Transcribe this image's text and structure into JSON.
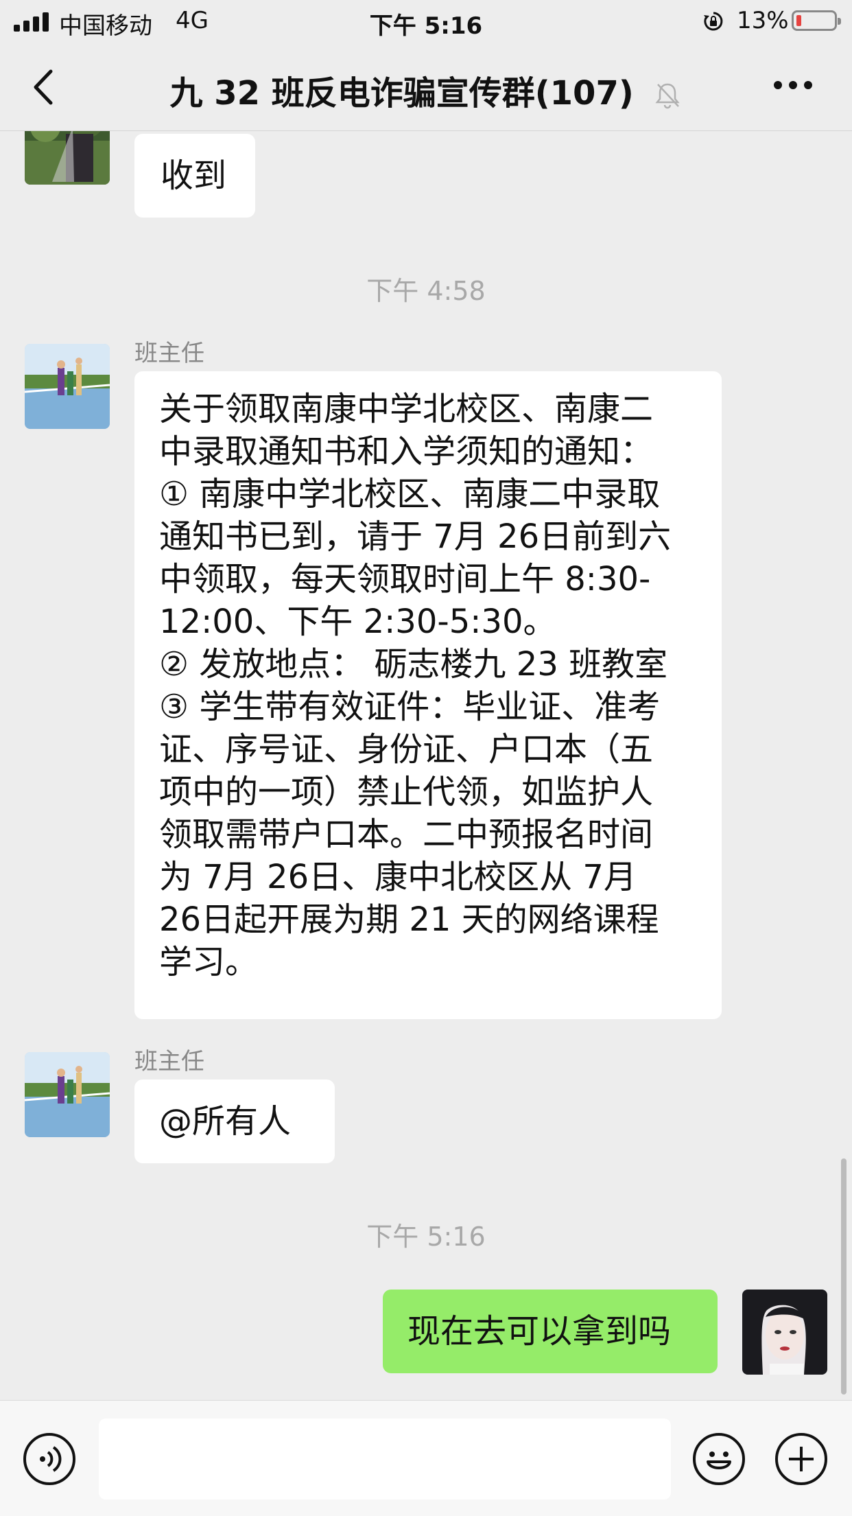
{
  "status_bar": {
    "carrier": "中国移动",
    "network": "4G",
    "time": "下午 5:16",
    "battery_percent": "13%",
    "battery_level": 0.13
  },
  "nav": {
    "title": "九 32 班反电诈骗宣传群(107)",
    "back_icon": "chevron-left-icon",
    "mute_icon": "bell-slash-icon",
    "more_icon": "ellipsis-icon"
  },
  "messages": {
    "m1": {
      "text": "收到"
    },
    "ts1": "下午 4:58",
    "m2": {
      "sender": "班主任",
      "lines": [
        "关于领取南康中学北校区、南康二",
        "中录取通知书和入学须知的通知：",
        "① 南康中学北校区、南康二中录取",
        "通知书已到，请于 7月 26日前到六",
        "中领取，每天领取时间上午 8:30-",
        "12:00、下午 2:30-5:30。",
        "② 发放地点：  砺志楼九 23 班教室",
        "③ 学生带有效证件：毕业证、准考",
        "证、序号证、身份证、户口本（五",
        "项中的一项）禁止代领，如监护人",
        "领取需带户口本。二中预报名时间",
        "为 7月  26日、康中北校区从 7月",
        "26日起开展为期 21 天的网络课程",
        "学习。"
      ]
    },
    "m3": {
      "sender": "班主任",
      "text": "@所有人"
    },
    "ts2": "下午 5:16",
    "m4": {
      "text": "现在去可以拿到吗"
    }
  },
  "input_bar": {
    "voice_icon": "voice-icon",
    "emoji_icon": "emoji-icon",
    "plus_icon": "plus-icon"
  },
  "colors": {
    "background": "#ededed",
    "bubble_incoming": "#ffffff",
    "bubble_outgoing": "#95ec69",
    "battery_low": "#e64340"
  }
}
